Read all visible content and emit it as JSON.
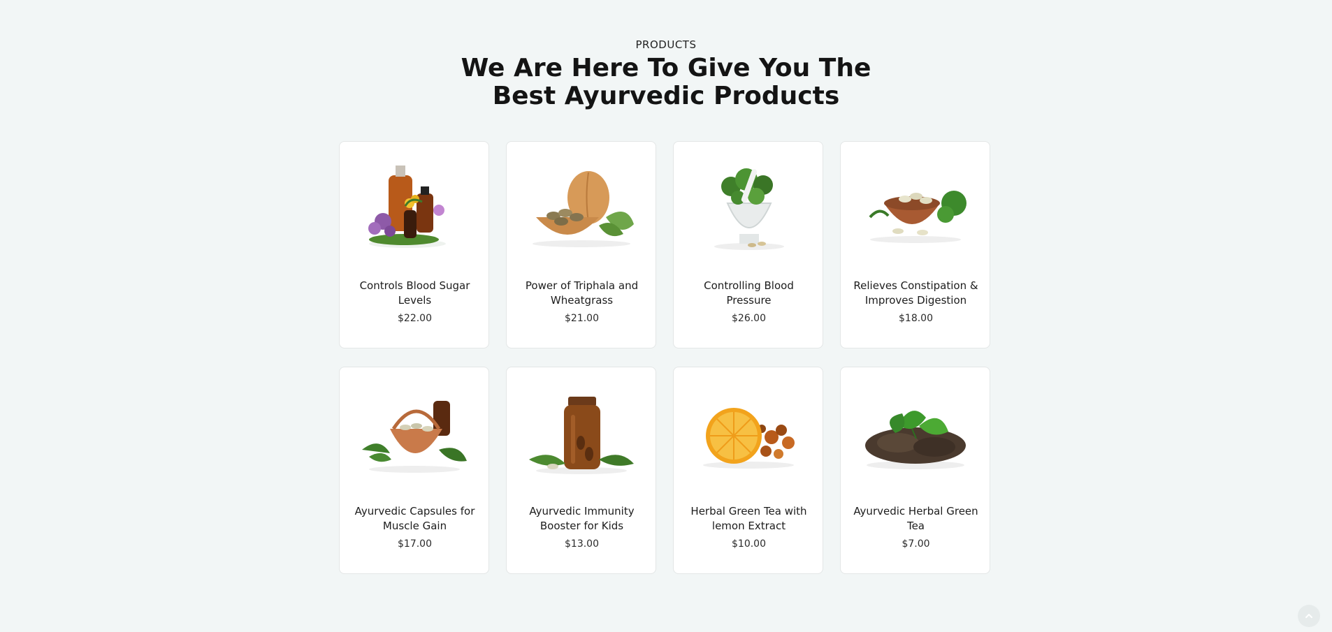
{
  "section": {
    "eyebrow": "PRODUCTS",
    "heading_line1": "We Are Here To Give You The",
    "heading_line2": "Best Ayurvedic Products"
  },
  "products": [
    {
      "title": "Controls Blood Sugar Levels",
      "price": "$22.00",
      "image": "oil-bottles-with-flowers"
    },
    {
      "title": "Power of Triphala and Wheatgrass",
      "price": "$21.00",
      "image": "walnut-shell-with-tablets"
    },
    {
      "title": "Controlling Blood Pressure",
      "price": "$26.00",
      "image": "mortar-with-herbs"
    },
    {
      "title": "Relieves Constipation & Improves Digestion",
      "price": "$18.00",
      "image": "clay-bowl-with-capsules"
    },
    {
      "title": "Ayurvedic Capsules for Muscle Gain",
      "price": "$17.00",
      "image": "basket-with-capsules"
    },
    {
      "title": "Ayurvedic Immunity Booster for Kids",
      "price": "$13.00",
      "image": "amber-jar-with-capsules"
    },
    {
      "title": "Herbal Green Tea with lemon Extract",
      "price": "$10.00",
      "image": "dried-orange-with-tea"
    },
    {
      "title": "Ayurvedic Herbal Green Tea",
      "price": "$7.00",
      "image": "green-tea-leaves"
    }
  ],
  "colors": {
    "background": "#f2f6f6",
    "card": "#ffffff",
    "text": "#1a1a1a"
  },
  "icons": {
    "scroll_top": "chevron-up-icon"
  }
}
